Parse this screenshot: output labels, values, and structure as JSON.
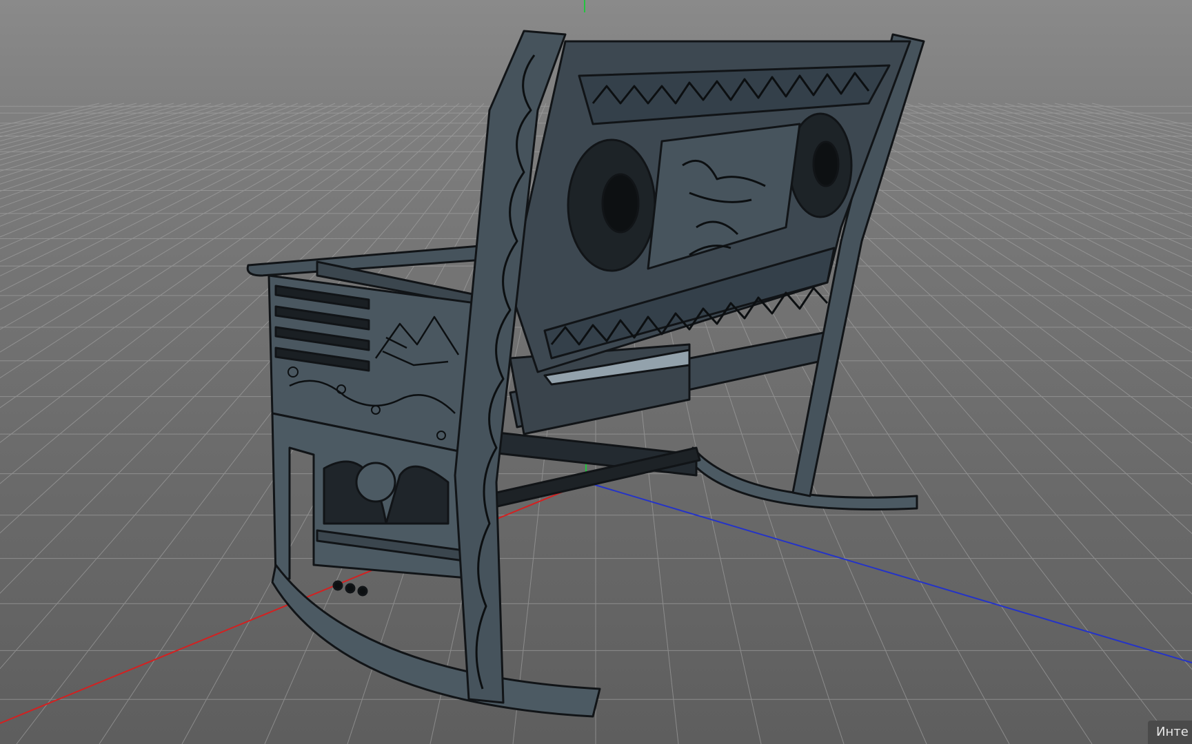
{
  "viewport": {
    "mode_label": "Инте",
    "background_color": "#7a7a7a",
    "grid_color": "#9a9a9a",
    "axis_colors": {
      "x": "#d02020",
      "y": "#20c040",
      "z": "#2030c0"
    }
  },
  "model": {
    "description_icon": "rocking-bench-model",
    "shade_color": "#3c4750",
    "edge_color": "#111417",
    "light_face_color": "#93a2ac"
  }
}
